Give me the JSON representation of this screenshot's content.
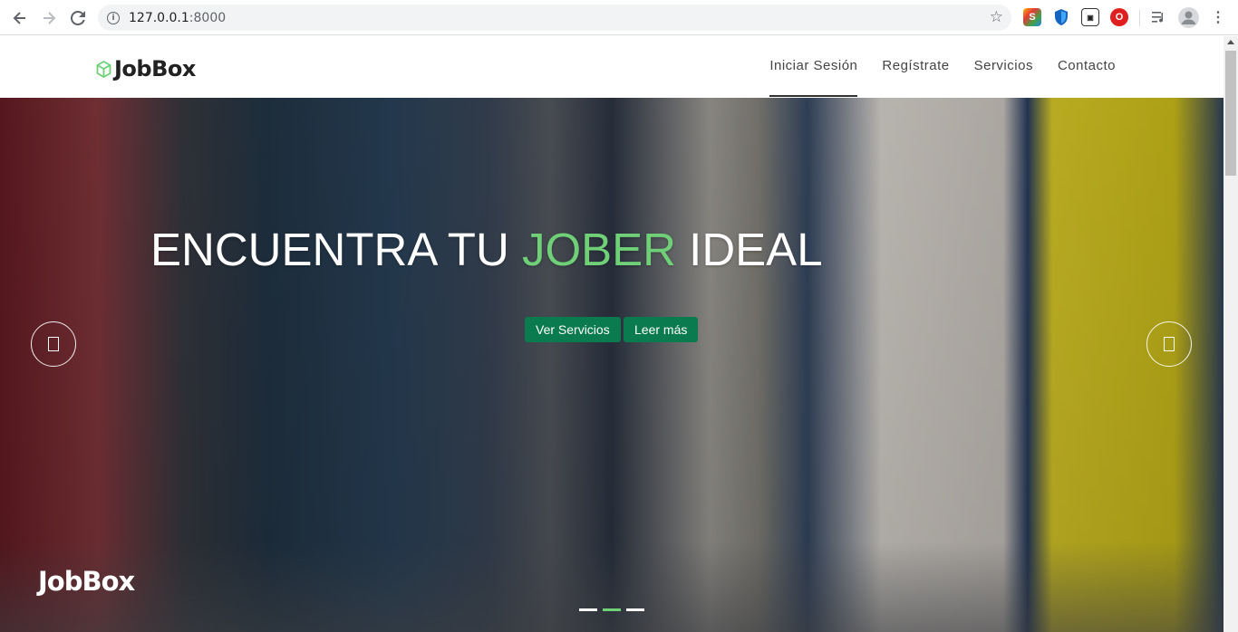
{
  "browser": {
    "back_icon": "arrow-left",
    "forward_icon": "arrow-right",
    "reload_icon": "reload",
    "url_host": "127.0.0.1",
    "url_port": ":8000",
    "bookmark_icon": "star-outline",
    "extensions": [
      "swirl-extension",
      "shield-extension",
      "media-extension",
      "opera-extension"
    ],
    "menu_icons": [
      "reading-list",
      "profile-avatar",
      "kebab-menu"
    ]
  },
  "site": {
    "brand_name": "JobBox",
    "brand_color": "#6fd078",
    "nav": [
      {
        "label": "Iniciar Sesión",
        "active": true
      },
      {
        "label": "Regístrate",
        "active": false
      },
      {
        "label": "Servicios",
        "active": false
      },
      {
        "label": "Contacto",
        "active": false
      }
    ]
  },
  "hero": {
    "title_part1": "ENCUENTRA TU ",
    "title_highlight": "JOBER",
    "title_part2": " IDEAL",
    "btn_services": "Ver Servicios",
    "btn_more": "Leer más",
    "btn_color": "#0a7a4f",
    "watermark": "JobBox",
    "slides_total": 3,
    "slide_active": 2
  }
}
